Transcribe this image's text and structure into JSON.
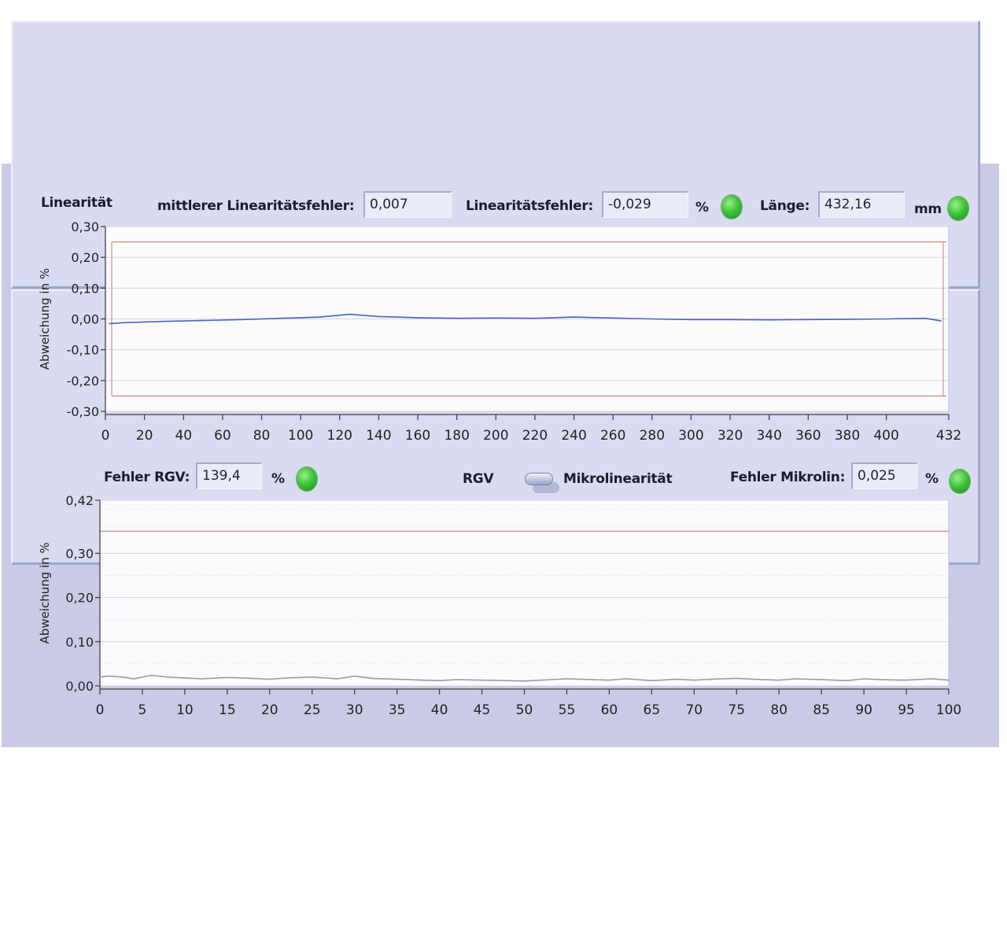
{
  "linearity": {
    "title": "Linearität",
    "mean_error_label": "mittlerer Linearitätsfehler:",
    "mean_error_value": "0,007",
    "error_label": "Linearitätsfehler:",
    "error_value": "-0,029",
    "error_unit": "%",
    "length_label": "Länge:",
    "length_value": "432,16",
    "length_unit": "mm",
    "error_led": "green",
    "length_led": "green"
  },
  "micro": {
    "rgv_error_label": "Fehler RGV:",
    "rgv_error_value": "139,4",
    "rgv_error_unit": "%",
    "rgv_led": "green",
    "switch_left_label": "RGV",
    "switch_right_label": "Mikrolinearität",
    "micro_error_label": "Fehler Mikrolin:",
    "micro_error_value": "0,025",
    "micro_error_unit": "%",
    "micro_led": "green"
  },
  "colors": {
    "trace": "#4a62c0",
    "limit": "#d27a7a",
    "trace2": "#9a9aa8",
    "led": "#3fc43a"
  },
  "chart_data": [
    {
      "type": "line",
      "ylabel": "Abweichung in %",
      "xlim": [
        0,
        432
      ],
      "ylim": [
        -0.3,
        0.3
      ],
      "x_ticks": [
        "0",
        "20",
        "40",
        "60",
        "80",
        "100",
        "120",
        "140",
        "160",
        "180",
        "200",
        "220",
        "240",
        "260",
        "280",
        "300",
        "320",
        "340",
        "360",
        "380",
        "400",
        "432"
      ],
      "y_ticks": [
        "0,30",
        "0,20",
        "0,10",
        "0,00",
        "-0,10",
        "-0,20",
        "-0,30"
      ],
      "limits": [
        0.25,
        -0.25
      ],
      "grid": true,
      "series": [
        {
          "x": [
            2,
            10,
            30,
            50,
            70,
            90,
            110,
            125,
            140,
            160,
            180,
            200,
            220,
            240,
            260,
            280,
            300,
            320,
            340,
            360,
            380,
            400,
            420,
            428
          ],
          "values": [
            -0.015,
            -0.012,
            -0.008,
            -0.005,
            -0.002,
            0.002,
            0.006,
            0.015,
            0.008,
            0.004,
            0.002,
            0.003,
            0.002,
            0.006,
            0.003,
            0.0,
            -0.002,
            -0.002,
            -0.003,
            -0.002,
            -0.001,
            0.0,
            0.002,
            -0.006
          ]
        }
      ]
    },
    {
      "type": "line",
      "ylabel": "Abweichung in %",
      "xlim": [
        0,
        100
      ],
      "ylim": [
        0,
        0.42
      ],
      "x_ticks": [
        "0",
        "5",
        "10",
        "15",
        "20",
        "25",
        "30",
        "35",
        "40",
        "45",
        "50",
        "55",
        "60",
        "65",
        "70",
        "75",
        "80",
        "85",
        "90",
        "95",
        "100"
      ],
      "y_ticks": [
        "0,42",
        "0,30",
        "0,20",
        "0,10",
        "0,00"
      ],
      "limits": [
        0.35
      ],
      "grid": true,
      "series": [
        {
          "x": [
            0,
            1,
            2,
            3,
            4,
            5,
            6,
            8,
            10,
            12,
            15,
            18,
            20,
            22,
            25,
            28,
            30,
            32,
            35,
            38,
            40,
            42,
            45,
            48,
            50,
            52,
            55,
            58,
            60,
            62,
            65,
            68,
            70,
            72,
            75,
            78,
            80,
            82,
            85,
            88,
            90,
            92,
            95,
            98,
            100
          ],
          "values": [
            0.02,
            0.022,
            0.021,
            0.019,
            0.016,
            0.02,
            0.024,
            0.02,
            0.018,
            0.016,
            0.019,
            0.017,
            0.015,
            0.018,
            0.02,
            0.016,
            0.022,
            0.017,
            0.015,
            0.013,
            0.012,
            0.014,
            0.013,
            0.012,
            0.011,
            0.013,
            0.016,
            0.014,
            0.013,
            0.016,
            0.012,
            0.015,
            0.013,
            0.015,
            0.017,
            0.014,
            0.013,
            0.016,
            0.014,
            0.012,
            0.016,
            0.014,
            0.013,
            0.016,
            0.013
          ]
        }
      ]
    }
  ]
}
